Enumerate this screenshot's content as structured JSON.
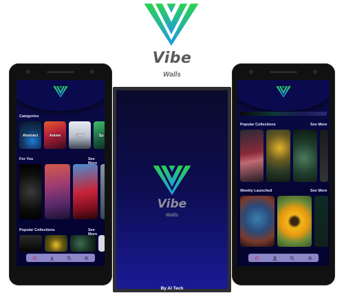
{
  "brand": {
    "name": "Vibe",
    "tagline": "Walls"
  },
  "colors": {
    "logo_top": "#2bd34e",
    "logo_bottom": "#1e9ae8",
    "app_bg": "#050536",
    "navbar": "#8d86c9"
  },
  "left_phone": {
    "categories_title": "Categories",
    "categories": [
      {
        "label": "Abstract"
      },
      {
        "label": "Anime"
      },
      {
        "label": "Cars"
      },
      {
        "label": "Sp"
      }
    ],
    "for_you_title": "For You",
    "for_you_see_more": "See More",
    "popular_title": "Popular Collections",
    "popular_see_more": "See More",
    "nav": [
      "home-icon",
      "download-icon",
      "search-icon",
      "settings-icon"
    ]
  },
  "splash": {
    "title": "Vibe",
    "subtitle": "Walls",
    "credit": "By AI Tech"
  },
  "right_phone": {
    "popular_title": "Popular Collections",
    "popular_see_more": "See More",
    "weekly_title": "Weekly Launched",
    "weekly_see_more": "See More",
    "nav": [
      "home-icon",
      "person-icon",
      "search-icon",
      "settings-icon"
    ]
  }
}
